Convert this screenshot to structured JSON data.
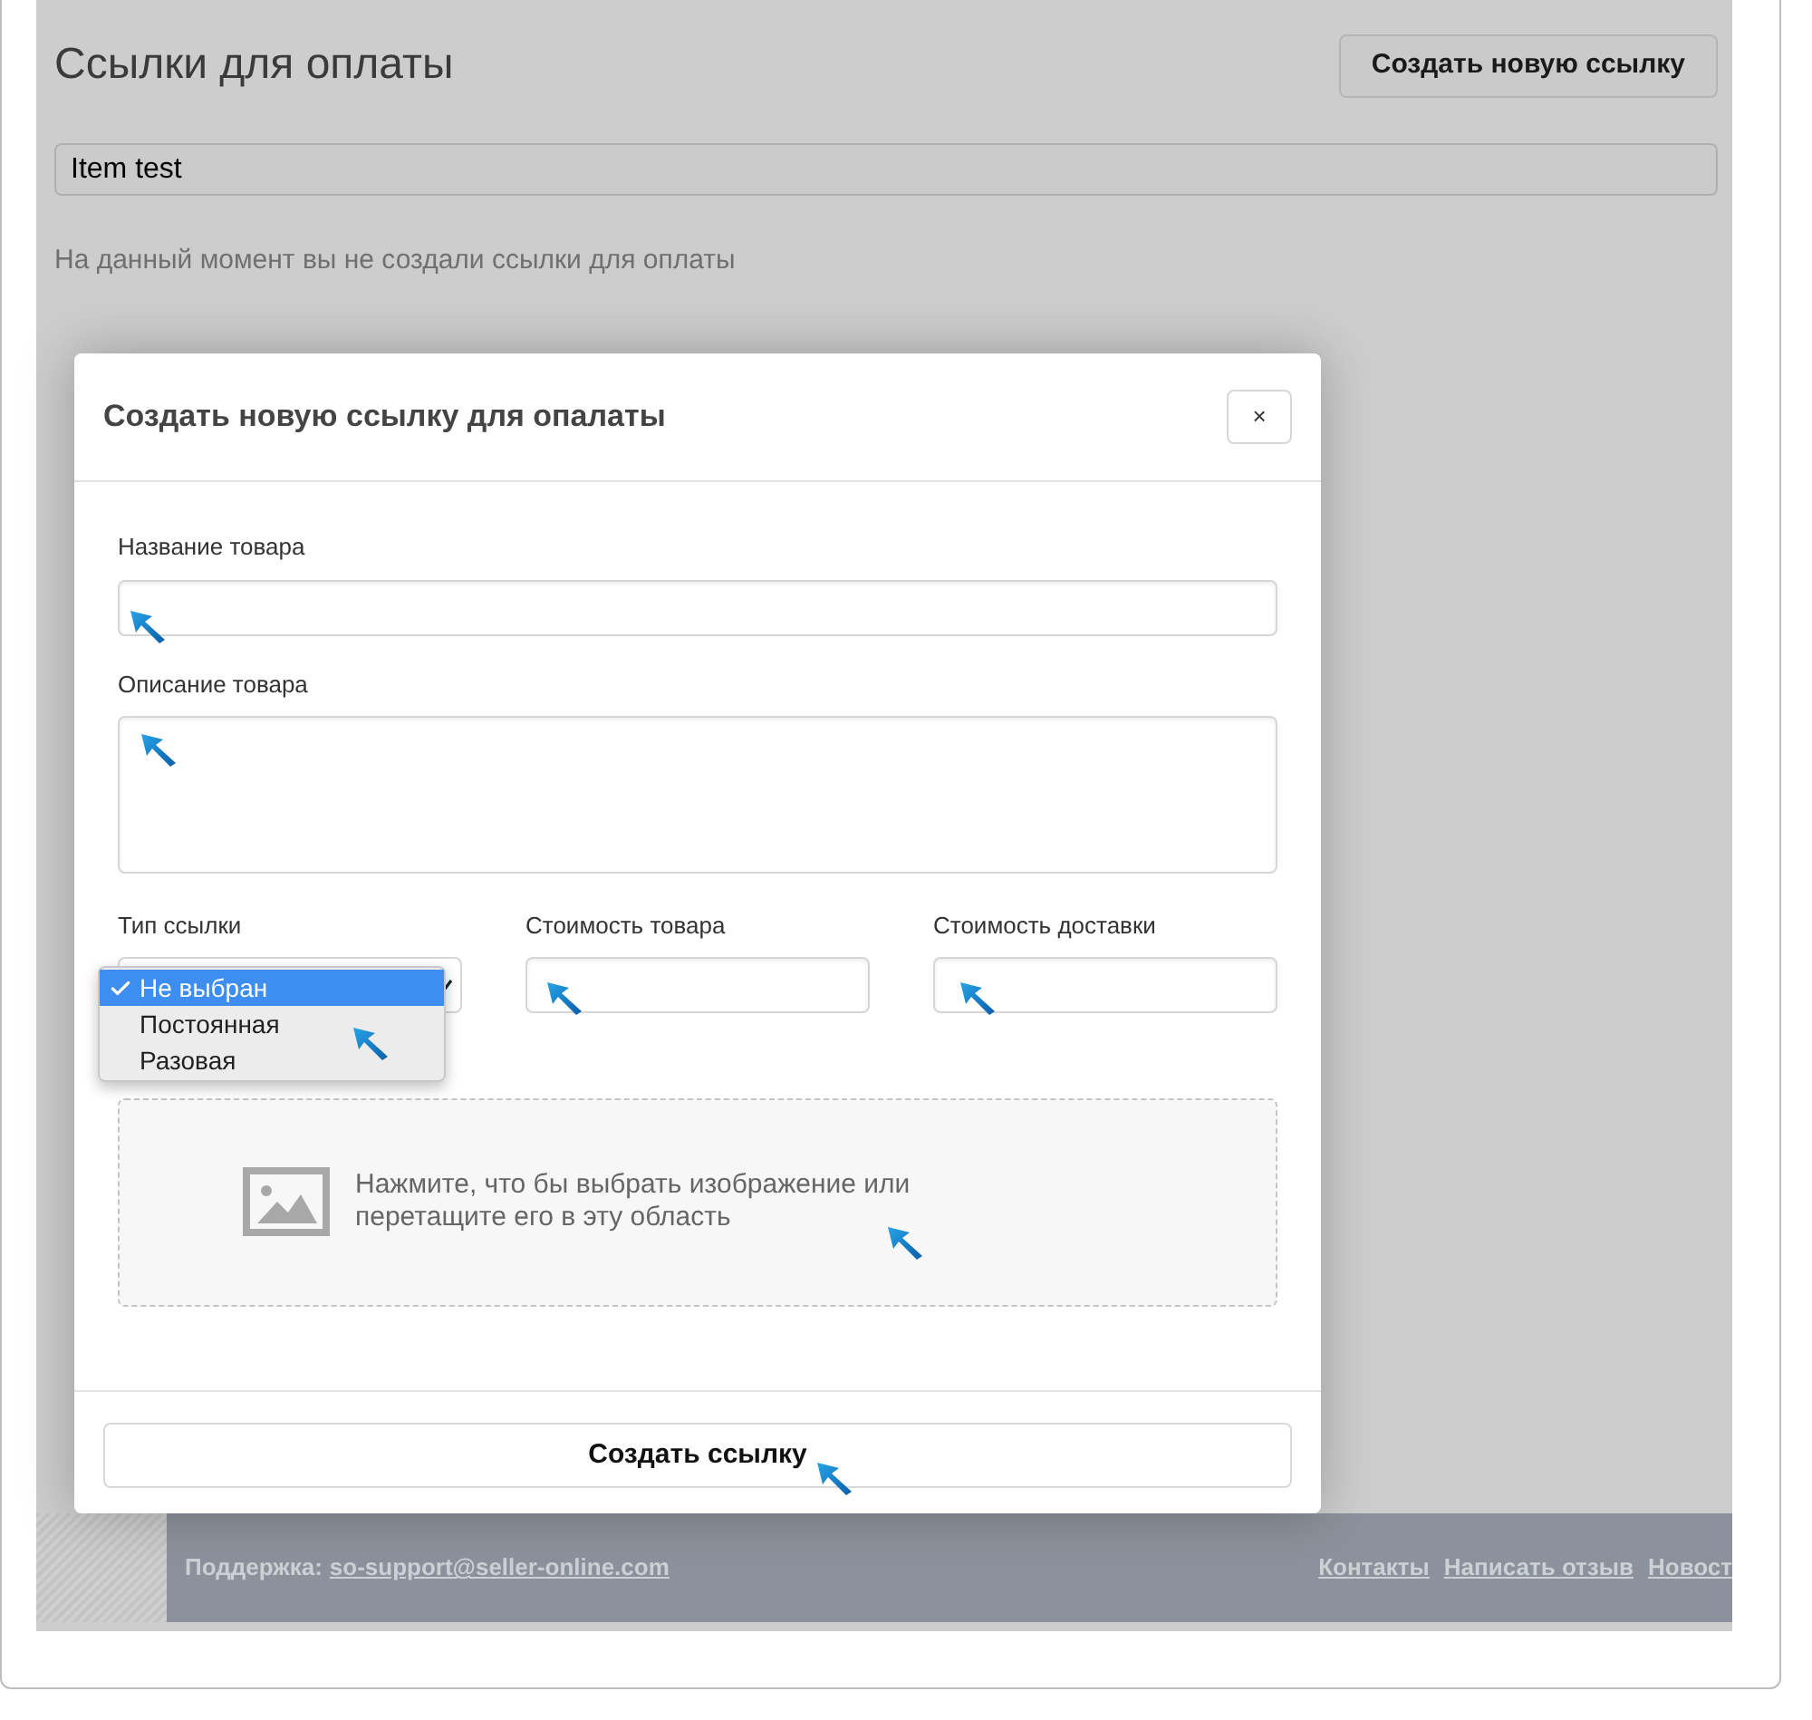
{
  "page": {
    "title": "Ссылки для оплаты",
    "create_button": "Создать новую ссылку",
    "search": {
      "value": "Item test"
    },
    "empty_message": "На данный момент вы не создали ссылки для оплаты"
  },
  "modal": {
    "title": "Создать новую ссылку для опалаты",
    "close": "×",
    "fields": [
      {
        "kind": "text",
        "label": "Название товара"
      },
      {
        "kind": "textarea",
        "label": "Описание товара"
      }
    ],
    "row_fields": [
      {
        "kind": "select",
        "label": "Тип ссылки",
        "options": [
          {
            "label": "Не выбран",
            "selected": true
          },
          {
            "label": "Постоянная",
            "selected": false
          },
          {
            "label": "Разовая",
            "selected": false
          }
        ]
      },
      {
        "kind": "text",
        "label": "Стоимость товара"
      },
      {
        "kind": "text",
        "label": "Стоимость доставки"
      }
    ],
    "dropzone": {
      "text": "Нажмите, что бы выбрать изображение или перетащите его в эту область"
    },
    "submit": "Создать ссылку"
  },
  "footer": {
    "support_label": "Поддержка:",
    "support_email": "so-support@seller-online.com",
    "links": [
      "Контакты",
      "Написать отзыв",
      "Новост"
    ]
  }
}
